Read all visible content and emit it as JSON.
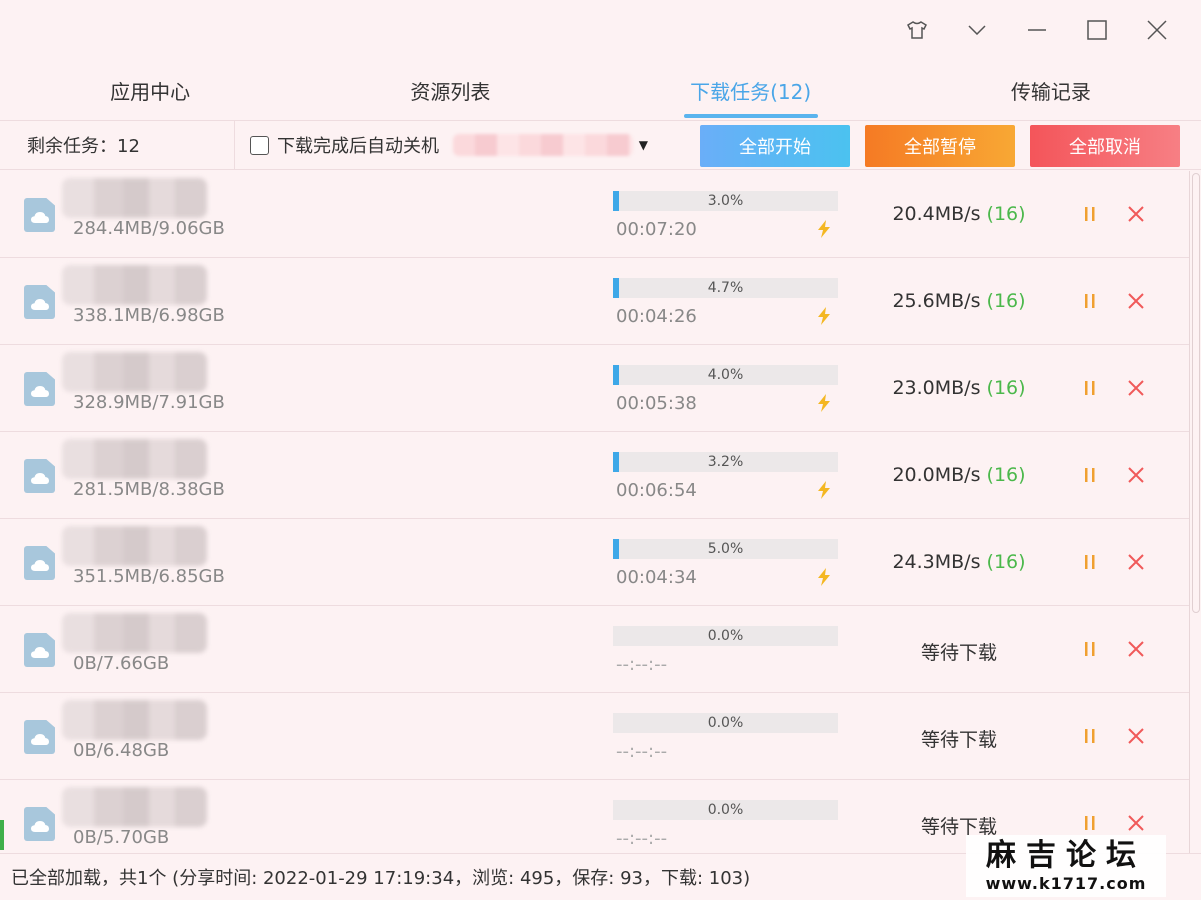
{
  "tabs": [
    {
      "label": "应用中心",
      "active": false
    },
    {
      "label": "资源列表",
      "active": false
    },
    {
      "label": "下载任务(12)",
      "active": true
    },
    {
      "label": "传输记录",
      "active": false
    }
  ],
  "toolbar": {
    "remaining": "剩余任务：12",
    "auto_shutdown": "下载完成后自动关机",
    "start_all": "全部开始",
    "pause_all": "全部暂停",
    "cancel_all": "全部取消"
  },
  "tasks": [
    {
      "size": "284.4MB/9.06GB",
      "progress": 3.0,
      "pct_label": "3.0%",
      "time": "00:07:20",
      "speed": "20.4MB/s",
      "threads": "(16)",
      "status": ""
    },
    {
      "size": "338.1MB/6.98GB",
      "progress": 4.7,
      "pct_label": "4.7%",
      "time": "00:04:26",
      "speed": "25.6MB/s",
      "threads": "(16)",
      "status": ""
    },
    {
      "size": "328.9MB/7.91GB",
      "progress": 4.0,
      "pct_label": "4.0%",
      "time": "00:05:38",
      "speed": "23.0MB/s",
      "threads": "(16)",
      "status": ""
    },
    {
      "size": "281.5MB/8.38GB",
      "progress": 3.2,
      "pct_label": "3.2%",
      "time": "00:06:54",
      "speed": "20.0MB/s",
      "threads": "(16)",
      "status": ""
    },
    {
      "size": "351.5MB/6.85GB",
      "progress": 5.0,
      "pct_label": "5.0%",
      "time": "00:04:34",
      "speed": "24.3MB/s",
      "threads": "(16)",
      "status": ""
    },
    {
      "size": "0B/7.66GB",
      "progress": 0.0,
      "pct_label": "0.0%",
      "time": "--:--:--",
      "speed": "",
      "threads": "",
      "status": "等待下载"
    },
    {
      "size": "0B/6.48GB",
      "progress": 0.0,
      "pct_label": "0.0%",
      "time": "--:--:--",
      "speed": "",
      "threads": "",
      "status": "等待下载"
    },
    {
      "size": "0B/5.70GB",
      "progress": 0.0,
      "pct_label": "0.0%",
      "time": "--:--:--",
      "speed": "",
      "threads": "",
      "status": "等待下载"
    }
  ],
  "status_bar": "已全部加载，共1个 (分享时间: 2022-01-29 17:19:34，浏览: 495，保存: 93，下载: 103)",
  "watermark": {
    "title": "麻吉论坛",
    "url": "www.k1717.com"
  },
  "colors": {
    "accent": "#4aa6e8",
    "progress": "#3ea8e8",
    "threads": "#4bb84b",
    "pause": "#f0a030",
    "close": "#f05a5a"
  }
}
